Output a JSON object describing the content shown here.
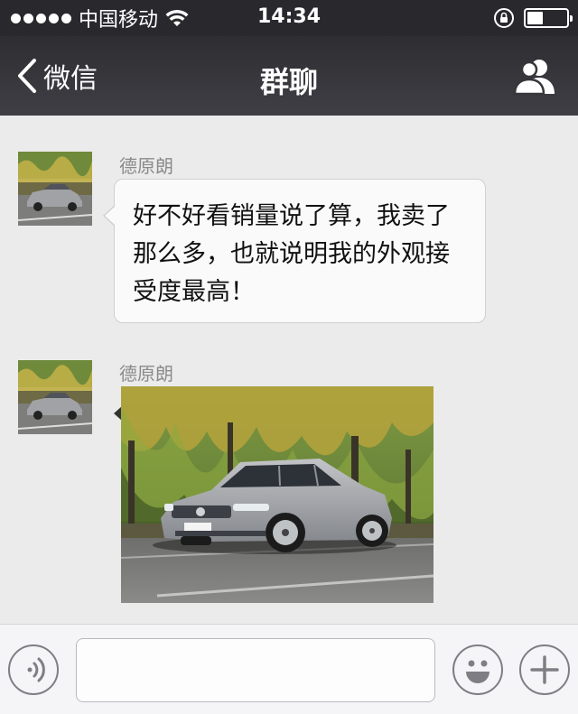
{
  "status_bar": {
    "carrier": "中国移动",
    "time": "14:34",
    "signal_bars": 5,
    "battery_level": 0.4,
    "icons": [
      "signal-dots-icon",
      "wifi-icon",
      "rotation-lock-icon",
      "battery-icon"
    ]
  },
  "nav": {
    "back_label": "微信",
    "title": "群聊",
    "icons": [
      "back-chevron-icon",
      "group-members-icon"
    ]
  },
  "messages": [
    {
      "sender": "德原朗",
      "type": "text",
      "text": "好不好看销量说了算，我卖了那么多，也就说明我的外观接受度最高！"
    },
    {
      "sender": "德原朗",
      "type": "image",
      "image_description": "silver sedan parked in front of willow trees"
    }
  ],
  "input_bar": {
    "value": "",
    "icons": [
      "voice-icon",
      "emoji-icon",
      "plus-icon"
    ]
  },
  "colors": {
    "nav_bar": "#2e2d32",
    "chat_background": "#ebebeb",
    "bubble": "#fafafa"
  }
}
